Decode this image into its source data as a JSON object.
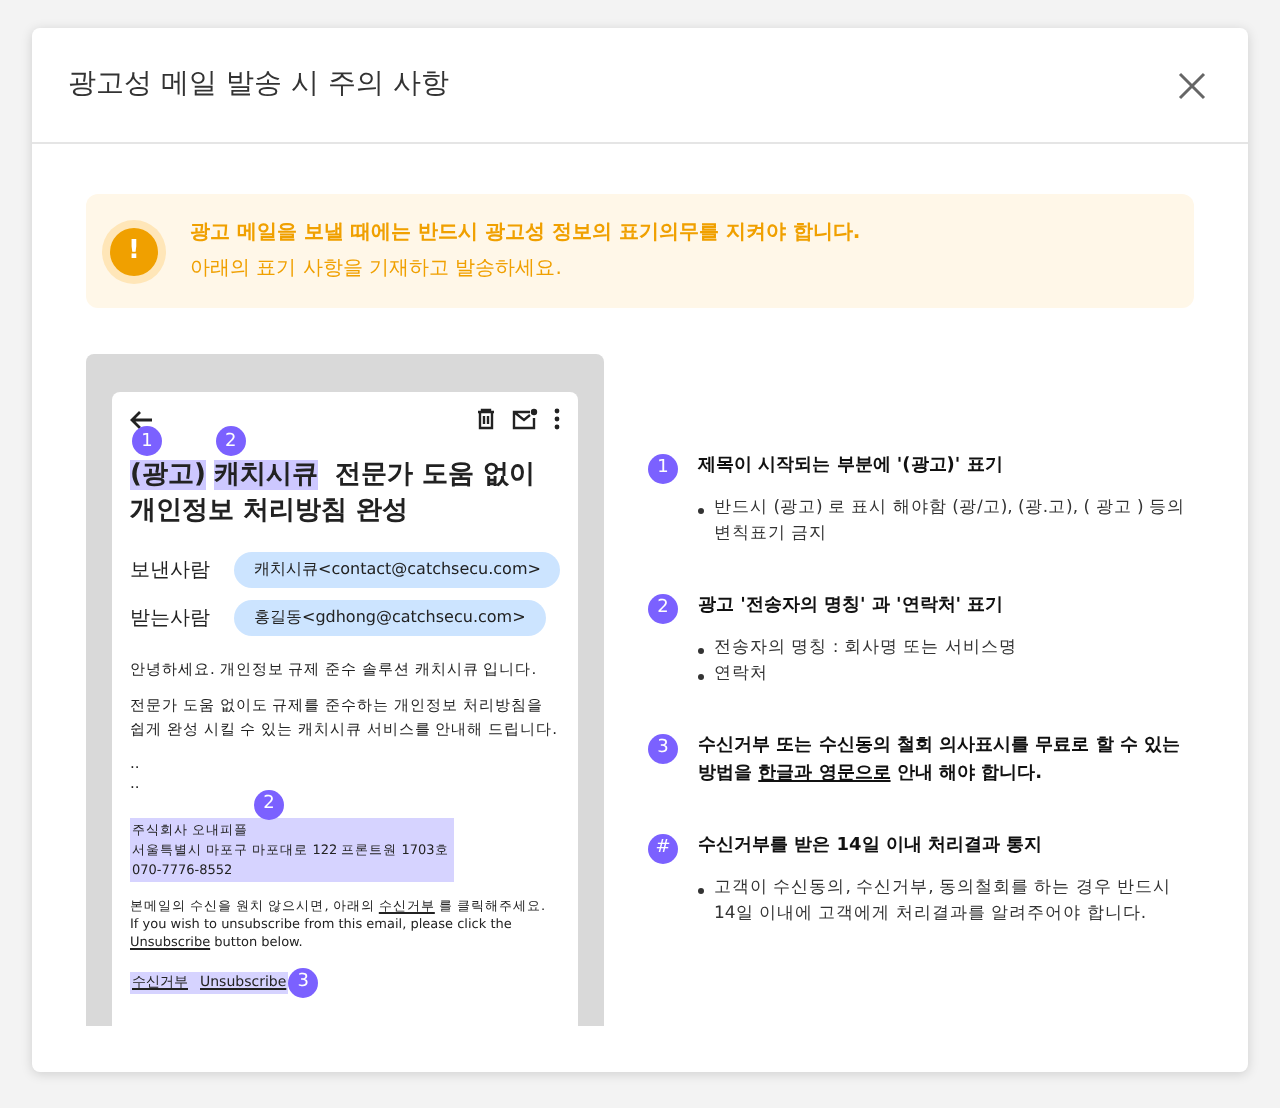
{
  "dialog": {
    "title": "광고성 메일 발송 시 주의 사항"
  },
  "notice": {
    "title": "광고 메일을 보낼 때에는 반드시 광고성 정보의 표기의무를 지켜야 합니다.",
    "subtitle": "아래의 표기 사항을 기재하고 발송하세요.",
    "icon": "!"
  },
  "preview": {
    "title_parts": [
      {
        "text": "(광고)",
        "highlight": true,
        "badge": "1"
      },
      {
        "text": "캐치시큐",
        "highlight": true,
        "badge": "2"
      },
      {
        "text": " 전문가 도움 없이 개인정보 처리방침 완성",
        "highlight": false
      }
    ],
    "fields": [
      {
        "label": "보낸사람",
        "value": "캐치시큐<contact@catchsecu.com>"
      },
      {
        "label": "받는사람",
        "value": "홍길동<gdhong@catchsecu.com>"
      }
    ],
    "body": [
      "안녕하세요. 개인정보 규제 준수 솔루션 캐치시큐 입니다.",
      "전문가 도움 없이도 규제를 준수하는 개인정보 처리방침을 쉽게 완성 시킬 수 있는 캐치시큐 서비스를 안내해 드립니다.",
      "..",
      ".."
    ],
    "footer": {
      "badge": "2",
      "lines": [
        "주식회사 오내피플",
        "서울특별시 마포구 마포대로 122 프론트원 1703호",
        "070-7776-8552"
      ]
    },
    "notes": [
      [
        {
          "text": "본메일의 수신을 원치 않으시면, 아래의 ",
          "underline": false
        },
        {
          "text": "수신거부",
          "underline": true
        },
        {
          "text": " 를 클릭해주세요.",
          "underline": false
        }
      ],
      [
        {
          "text": "If you wish to unsubscribe from this email, please click the ",
          "underline": false
        },
        {
          "text": "Unsubscribe",
          "underline": true
        },
        {
          "text": " button below.",
          "underline": false
        }
      ]
    ],
    "links": [
      "수신거부",
      "Unsubscribe"
    ],
    "links_badge": "3"
  },
  "guide": [
    {
      "badge": "1",
      "title_parts": [
        {
          "text": "제목이 시작되는 부분에 '(광고)' 표기",
          "underline": false
        }
      ],
      "bullets": [
        "반드시 (광고) 로 표시 해야함 (광/고), (광.고), ( 광고 ) 등의 변칙표기 금지"
      ]
    },
    {
      "badge": "2",
      "title_parts": [
        {
          "text": "광고 '전송자의 명칭' 과 '연락처' 표기",
          "underline": false
        }
      ],
      "bullets": [
        "전송자의 명칭 : 회사명 또는 서비스명",
        "연락처"
      ]
    },
    {
      "badge": "3",
      "title_parts": [
        {
          "text": "수신거부 또는 수신동의 철회 의사표시를 무료로 할 수 있는 방법을 ",
          "underline": false
        },
        {
          "text": "한글과 영문으로",
          "underline": true
        },
        {
          "text": " 안내 해야 합니다.",
          "underline": false
        }
      ]
    },
    {
      "badge": "#",
      "title_parts": [
        {
          "text": "수신거부를 받은 14일 이내 처리결과 통지",
          "underline": false
        }
      ],
      "bullets": [
        "고객이 수신동의, 수신거부, 동의철회를 하는 경우 반드시 14일 이내에 고객에게 처리결과를 알려주어야 합니다."
      ]
    }
  ]
}
